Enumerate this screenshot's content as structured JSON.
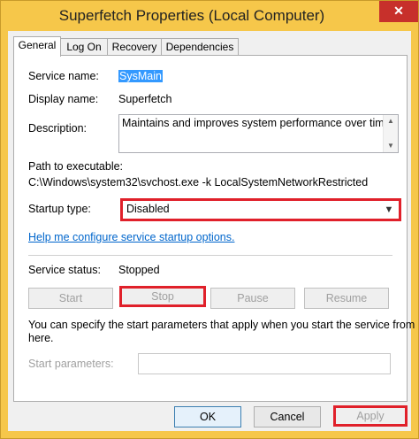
{
  "window": {
    "title": "Superfetch Properties (Local Computer)",
    "close_glyph": "✕"
  },
  "tabs": [
    {
      "label": "General",
      "active": true
    },
    {
      "label": "Log On",
      "active": false
    },
    {
      "label": "Recovery",
      "active": false
    },
    {
      "label": "Dependencies",
      "active": false
    }
  ],
  "general": {
    "service_name_label": "Service name:",
    "service_name_value": "SysMain",
    "display_name_label": "Display name:",
    "display_name_value": "Superfetch",
    "description_label": "Description:",
    "description_value": "Maintains and improves system performance over time.",
    "path_label": "Path to executable:",
    "path_value": "C:\\Windows\\system32\\svchost.exe -k LocalSystemNetworkRestricted",
    "startup_type_label": "Startup type:",
    "startup_type_value": "Disabled",
    "help_link": "Help me configure service startup options.",
    "status_label": "Service status:",
    "status_value": "Stopped",
    "start_label": "Start",
    "stop_label": "Stop",
    "pause_label": "Pause",
    "resume_label": "Resume",
    "info_line1": "You can specify the start parameters that apply when you start the service from",
    "info_line2": "here.",
    "params_label": "Start parameters:",
    "params_value": ""
  },
  "footer": {
    "ok_label": "OK",
    "cancel_label": "Cancel",
    "apply_label": "Apply"
  },
  "colors": {
    "window_frame": "#f6c74a",
    "close_button": "#c7302b",
    "highlight_box": "#e0202a",
    "selection": "#3399ff",
    "link": "#0066cc"
  },
  "icons": {
    "close": "close-icon",
    "dropdown": "chevron-down-icon",
    "scroll_up": "scroll-up-icon",
    "scroll_down": "scroll-down-icon"
  }
}
